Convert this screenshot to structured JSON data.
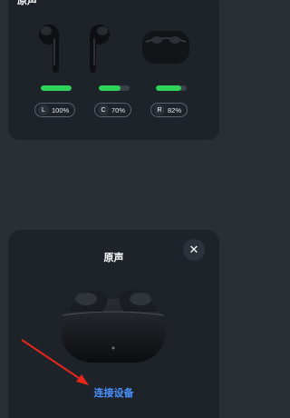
{
  "top_card": {
    "title": "原声",
    "devices": [
      {
        "label": "L",
        "percent": "100%",
        "level": 1.0
      },
      {
        "label": "C",
        "percent": "70%",
        "level": 0.7
      },
      {
        "label": "R",
        "percent": "82%",
        "level": 0.82
      }
    ]
  },
  "popup": {
    "title": "原声",
    "close_icon": "close-icon",
    "connect_label": "连接设备"
  },
  "colors": {
    "background": "#2a2f36",
    "card": "#1e2329",
    "battery": "#2fd25a",
    "link": "#4a90ff",
    "annotation_arrow": "#e8261c"
  }
}
